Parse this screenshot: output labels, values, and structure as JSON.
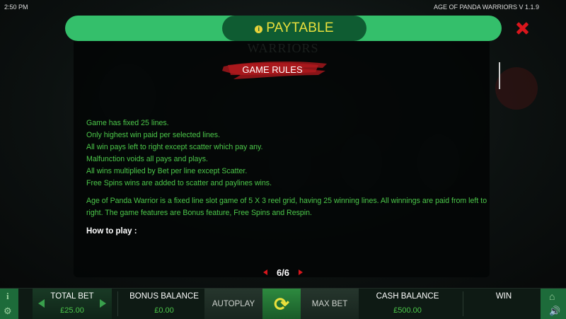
{
  "status": {
    "time": "2:50 PM",
    "version": "AGE OF PANDA WARRIORS V 1.1.9"
  },
  "header": {
    "title": "PAYTABLE",
    "info_icon": "i"
  },
  "panel": {
    "watermark": "WARRIORS",
    "section_title": "GAME RULES",
    "rules": [
      "Game has fixed 25 lines.",
      "Only highest win paid per selected lines.",
      "All win pays left to right except scatter which pay any.",
      "Malfunction voids all pays and plays.",
      "All wins multiplied by Bet per line except Scatter.",
      "Free Spins wins are added to scatter and paylines wins."
    ],
    "description": "Age of Panda Warrior is a fixed line slot game of 5 X 3 reel grid, having 25 winning lines. All winnings are paid from left to right. The game features are Bonus feature, Free Spins and Respin.",
    "how_to_play": "How to play :"
  },
  "pager": {
    "label": "6/6"
  },
  "bottom_bar": {
    "info": "i",
    "total_bet_label": "TOTAL BET",
    "total_bet_value": "£25.00",
    "bonus_balance_label": "BONUS BALANCE",
    "bonus_balance_value": "£0.00",
    "autoplay_label": "AUTOPLAY",
    "max_bet_label": "MAX BET",
    "cash_balance_label": "CASH BALANCE",
    "cash_balance_value": "£500.00",
    "win_label": "WIN"
  },
  "colors": {
    "accent_green": "#34bf6b",
    "title_yellow": "#e9e03c",
    "close_red": "#d9161c",
    "rule_text": "#4cc84a"
  }
}
